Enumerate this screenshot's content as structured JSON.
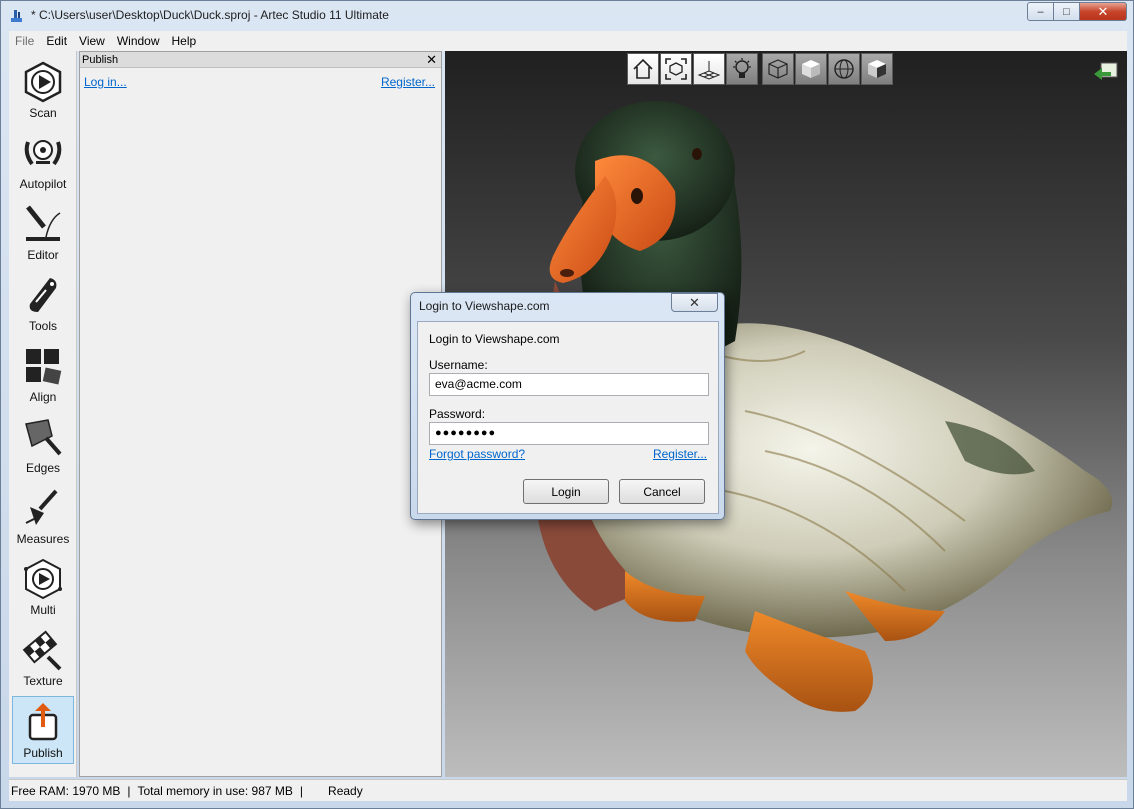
{
  "window": {
    "title": "* C:\\Users\\user\\Desktop\\Duck\\Duck.sproj - Artec Studio 11 Ultimate",
    "minimize": "–",
    "maximize": "□",
    "close": "✕"
  },
  "menu": [
    "File",
    "Edit",
    "View",
    "Window",
    "Help"
  ],
  "tools": [
    {
      "label": "Scan",
      "icon": "scan-icon"
    },
    {
      "label": "Autopilot",
      "icon": "autopilot-icon"
    },
    {
      "label": "Editor",
      "icon": "editor-icon"
    },
    {
      "label": "Tools",
      "icon": "tools-icon"
    },
    {
      "label": "Align",
      "icon": "align-icon"
    },
    {
      "label": "Edges",
      "icon": "edges-icon"
    },
    {
      "label": "Measures",
      "icon": "measures-icon"
    },
    {
      "label": "Multi",
      "icon": "multi-icon"
    },
    {
      "label": "Texture",
      "icon": "texture-icon"
    },
    {
      "label": "Publish",
      "icon": "publish-icon",
      "active": true
    }
  ],
  "panel": {
    "title": "Publish",
    "close": "✕",
    "login_link": "Log in...",
    "register_link": "Register..."
  },
  "viewport": {
    "toolbar": [
      "home-icon",
      "fit-view-icon",
      "grid-icon",
      "light-icon",
      "wireframe-box-icon",
      "solid-box-icon",
      "sphere-icon",
      "textured-box-icon"
    ],
    "corner_icon": "back-arrow-icon"
  },
  "status": {
    "free_ram": "Free RAM: 1970 MB",
    "separator": "|",
    "total_memory": "Total memory in use: 987 MB",
    "state": "Ready"
  },
  "dialog": {
    "title": "Login to Viewshape.com",
    "close": "✕",
    "heading": "Login to Viewshape.com",
    "username_label": "Username:",
    "username_value": "eva@acme.com",
    "password_label": "Password:",
    "password_value": "●●●●●●●●",
    "forgot_link": "Forgot password?",
    "register_link": "Register...",
    "login_button": "Login",
    "cancel_button": "Cancel"
  }
}
